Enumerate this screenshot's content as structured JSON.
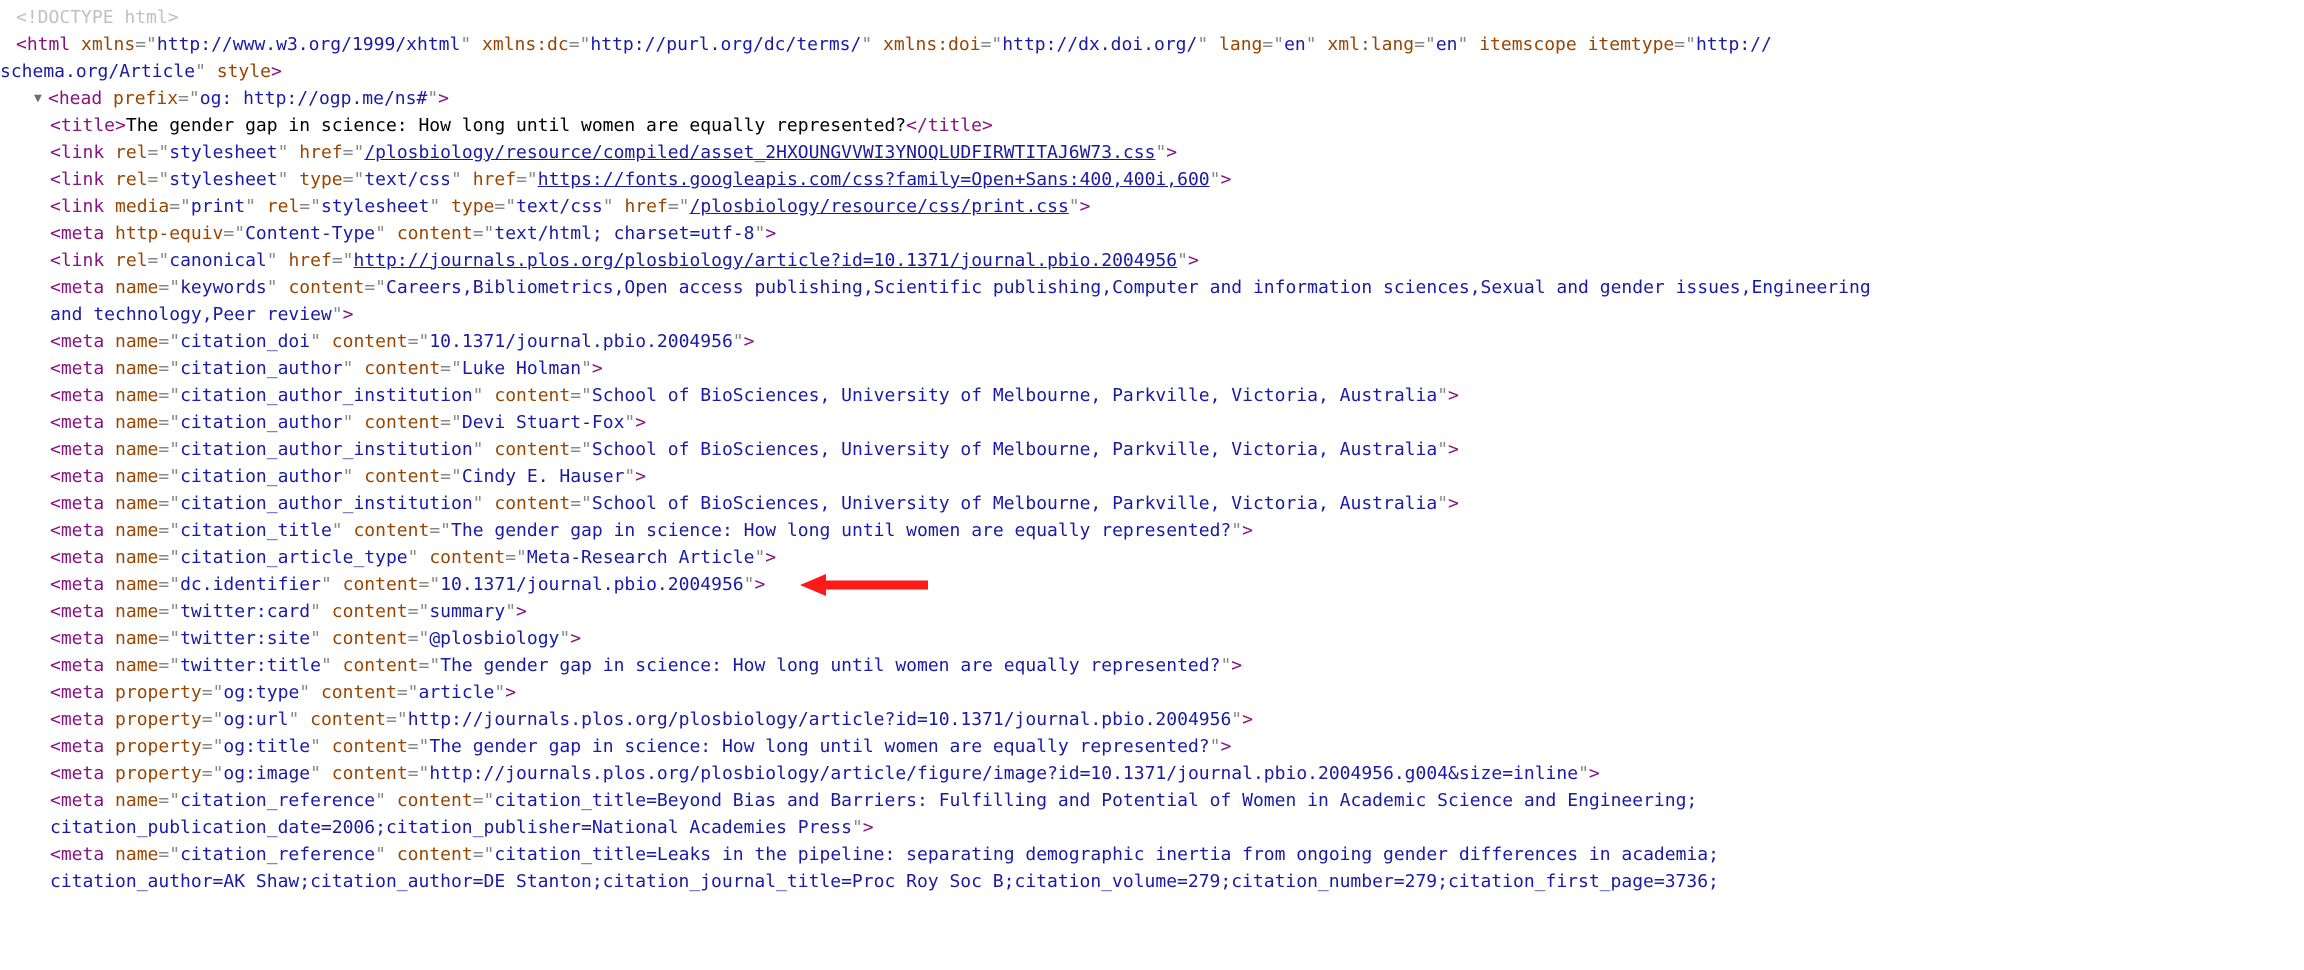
{
  "doctype": "<!DOCTYPE html>",
  "html_open": {
    "xmlns": "http://www.w3.org/1999/xhtml",
    "xmlns_dc": "http://purl.org/dc/terms/",
    "xmlns_doi": "http://dx.doi.org/",
    "lang": "en",
    "xml_lang": "en",
    "itemtype": "http://schema.org/Article"
  },
  "head_open": {
    "prefix": "og: http://ogp.me/ns#"
  },
  "title_text": "The gender gap in science: How long until women are equally represented?",
  "link1": {
    "rel": "stylesheet",
    "href": "/plosbiology/resource/compiled/asset_2HXOUNGVVWI3YNOQLUDFIRWTITAJ6W73.css"
  },
  "link2": {
    "rel": "stylesheet",
    "type": "text/css",
    "href": "https://fonts.googleapis.com/css?family=Open+Sans:400,400i,600"
  },
  "link3": {
    "media": "print",
    "rel": "stylesheet",
    "type": "text/css",
    "href": "/plosbiology/resource/css/print.css"
  },
  "meta_httpequiv": {
    "he": "Content-Type",
    "content": "text/html; charset=utf-8"
  },
  "link_canonical": {
    "rel": "canonical",
    "href": "http://journals.plos.org/plosbiology/article?id=10.1371/journal.pbio.2004956"
  },
  "meta_keywords": {
    "name": "keywords",
    "content_a": "Careers,Bibliometrics,Open access publishing,Scientific publishing,Computer and information sciences,Sexual and gender issues,Engineering ",
    "content_b": "and technology,Peer review"
  },
  "meta_doi": {
    "name": "citation_doi",
    "content": "10.1371/journal.pbio.2004956"
  },
  "meta_auth1": {
    "name": "citation_author",
    "content": "Luke Holman"
  },
  "meta_inst1": {
    "name": "citation_author_institution",
    "content": "School of BioSciences, University of Melbourne, Parkville, Victoria, Australia"
  },
  "meta_auth2": {
    "name": "citation_author",
    "content": "Devi Stuart-Fox"
  },
  "meta_inst2": {
    "name": "citation_author_institution",
    "content": "School of BioSciences, University of Melbourne, Parkville, Victoria, Australia"
  },
  "meta_auth3": {
    "name": "citation_author",
    "content": "Cindy E. Hauser"
  },
  "meta_inst3": {
    "name": "citation_author_institution",
    "content": "School of BioSciences, University of Melbourne, Parkville, Victoria, Australia"
  },
  "meta_cittitle": {
    "name": "citation_title",
    "content": "The gender gap in science: How long until women are equally represented?"
  },
  "meta_arttype": {
    "name": "citation_article_type",
    "content": "Meta-Research Article"
  },
  "meta_dcid": {
    "name": "dc.identifier",
    "content": "10.1371/journal.pbio.2004956"
  },
  "meta_twcard": {
    "name": "twitter:card",
    "content": "summary"
  },
  "meta_twsite": {
    "name": "twitter:site",
    "content": "@plosbiology"
  },
  "meta_twtitle": {
    "name": "twitter:title",
    "content": "The gender gap in science: How long until women are equally represented?"
  },
  "meta_ogtype": {
    "prop": "og:type",
    "content": "article"
  },
  "meta_ogurl": {
    "prop": "og:url",
    "content": "http://journals.plos.org/plosbiology/article?id=10.1371/journal.pbio.2004956"
  },
  "meta_ogtitle": {
    "prop": "og:title",
    "content": "The gender gap in science: How long until women are equally represented?"
  },
  "meta_ogimage": {
    "prop": "og:image",
    "content": "http://journals.plos.org/plosbiology/article/figure/image?id=10.1371/journal.pbio.2004956.g004&size=inline"
  },
  "meta_ref1": {
    "name": "citation_reference",
    "content_a": "citation_title=Beyond Bias and Barriers: Fulfilling and Potential of Women in Academic Science and Engineering;",
    "content_b": "citation_publication_date=2006;citation_publisher=National Academies Press"
  },
  "meta_ref2": {
    "name": "citation_reference",
    "content_a": "citation_title=Leaks in the pipeline: separating demographic inertia from ongoing gender differences in academia;",
    "content_b": "citation_author=AK Shaw;citation_author=DE Stanton;citation_journal_title=Proc Roy Soc B;citation_volume=279;citation_number=279;citation_first_page=3736;"
  }
}
